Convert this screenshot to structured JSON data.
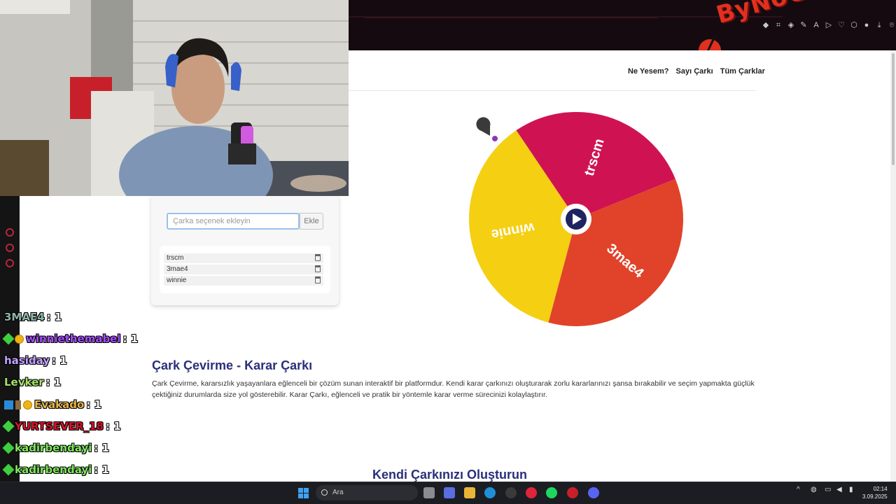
{
  "site": {
    "nav": [
      "Ne Yesem?",
      "Sayı Çarkı",
      "Tüm Çarklar"
    ],
    "input_placeholder": "Çarka seçenek ekleyin",
    "add_button": "Ekle",
    "options": [
      "trscm",
      "3mae4",
      "winnie"
    ],
    "wheel_labels": [
      "trscm",
      "3mae4",
      "winnie"
    ],
    "wheel_colors": [
      "#cf1352",
      "#e0432a",
      "#f5cf12"
    ],
    "heading": "Çark Çevirme - Karar Çarkı",
    "paragraph": "Çark Çevirme, kararsızlık yaşayanlara eğlenceli bir çözüm sunan interaktif bir platformdur. Kendi karar çarkınızı oluşturarak zorlu kararlarınızı şansa bırakabilir ve seçim yapmakta güçlük çektiğiniz durumlarda size yol gösterebilir. Karar Çarkı, eğlenceli ve pratik bir yöntemle karar verme sürecinizi kolaylaştırır.",
    "subheading": "Kendi Çarkınızı Oluşturun"
  },
  "overlay": {
    "logo_text": "ByNoGame",
    "chat": [
      {
        "user": "3MAE4",
        "count": ": 1",
        "color": "#8fb5a6",
        "badges": []
      },
      {
        "user": "winniethemabel",
        "count": ": 1",
        "color": "#a64dff",
        "badges": [
          "gem-icon",
          "coin-icon"
        ]
      },
      {
        "user": "hasiday",
        "count": ": 1",
        "color": "#c4a3ff",
        "badges": []
      },
      {
        "user": "Levker",
        "count": ": 1",
        "color": "#a6e36b",
        "badges": []
      },
      {
        "user": "Evakado",
        "count": ": 1",
        "color": "#e8b54a",
        "badges": [
          "cube-icon",
          "sword-icon",
          "coin-icon"
        ]
      },
      {
        "user": "YURTSEVER_18",
        "count": ": 1",
        "color": "#d4142a",
        "badges": [
          "gem-icon"
        ]
      },
      {
        "user": "kadirbendayi",
        "count": ": 1",
        "color": "#7ee85c",
        "badges": [
          "gem-icon"
        ]
      },
      {
        "user": "kadirbendayi",
        "count": ": 1",
        "color": "#7ee85c",
        "badges": [
          "gem-icon"
        ]
      },
      {
        "user": "kadirbendayi",
        "count": ": 1",
        "color": "#ffffff",
        "badges": [
          "gem-icon"
        ]
      }
    ]
  },
  "taskbar": {
    "search_label": "Ara",
    "time": "02:14",
    "date": "3.09.2025"
  }
}
